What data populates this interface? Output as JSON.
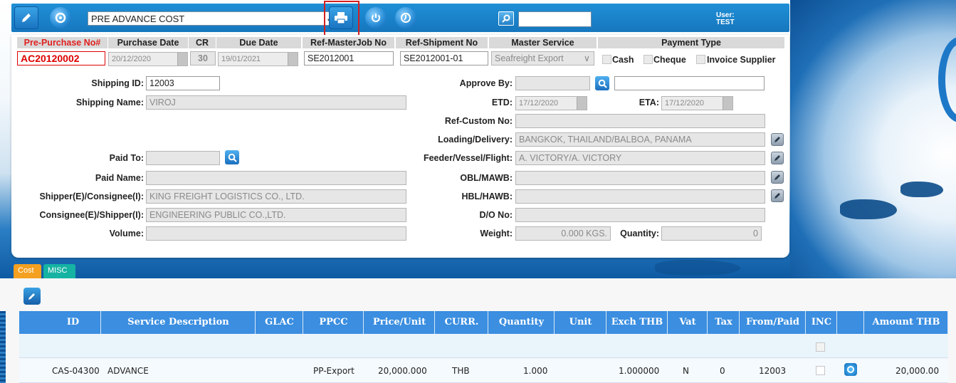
{
  "toolbar": {
    "document_type": "PRE ADVANCE COST",
    "user_label": "User:",
    "user_name": "TEST",
    "search_value": ""
  },
  "header": {
    "cols": [
      "Pre-Purchase No#",
      "Purchase Date",
      "CR",
      "Due Date",
      "Ref-MasterJob No",
      "Ref-Shipment No",
      "Master Service",
      "Payment Type"
    ],
    "pre_purchase_no": "AC20120002",
    "purchase_date": "20/12/2020",
    "cr": "30",
    "due_date": "19/01/2021",
    "ref_master_job_no": "SE2012001",
    "ref_shipment_no": "SE2012001-01",
    "master_service": "Seafreight Export",
    "payment": {
      "cash": "Cash",
      "cheque": "Cheque",
      "invoice_supplier": "Invoice Supplier"
    }
  },
  "form": {
    "labels": {
      "shipping_id": "Shipping ID:",
      "shipping_name": "Shipping Name:",
      "paid_to": "Paid To:",
      "paid_name": "Paid Name:",
      "shipper": "Shipper(E)/Consignee(I):",
      "consignee": "Consignee(E)/Shipper(I):",
      "volume": "Volume:",
      "approve_by": "Approve By:",
      "etd": "ETD:",
      "eta": "ETA:",
      "ref_custom_no": "Ref-Custom No:",
      "loading_delivery": "Loading/Delivery:",
      "feeder": "Feeder/Vessel/Flight:",
      "obl": "OBL/MAWB:",
      "hbl": "HBL/HAWB:",
      "do_no": "D/O No:",
      "weight": "Weight:",
      "quantity": "Quantity:"
    },
    "values": {
      "shipping_id": "12003",
      "shipping_name": "VIROJ",
      "paid_to": "",
      "paid_name": "",
      "shipper": "KING FREIGHT LOGISTICS CO., LTD.",
      "consignee": "ENGINEERING PUBLIC CO.,LTD.",
      "volume": "",
      "approve_by": "",
      "approve_by_name": "",
      "etd": "17/12/2020",
      "eta": "17/12/2020",
      "ref_custom_no": "",
      "loading_delivery": "BANGKOK, THAILAND/BALBOA, PANAMA",
      "feeder": "A. VICTORY/A. VICTORY",
      "obl": "",
      "hbl": "",
      "do_no": "",
      "weight": "0.000 KGS.",
      "quantity": "0"
    }
  },
  "tabs": [
    {
      "label": "Cost"
    },
    {
      "label": "MISC"
    }
  ],
  "grid": {
    "columns": [
      "ID",
      "Service Description",
      "GLAC",
      "PPCC",
      "Price/Unit",
      "CURR.",
      "Quantity",
      "Unit",
      "Exch THB",
      "Vat",
      "Tax",
      "From/Paid",
      "INC",
      "",
      "Amount THB"
    ],
    "rows": [
      {
        "id": "CAS-04300",
        "description": "ADVANCE",
        "glac": "",
        "ppcc": "PP-Export",
        "price_unit": "20,000.000",
        "curr": "THB",
        "quantity": "1.000",
        "unit": "",
        "exch_thb": "1.000000",
        "vat": "N",
        "tax": "0",
        "from_paid": "12003",
        "amount_thb": "20,000.00"
      }
    ]
  }
}
